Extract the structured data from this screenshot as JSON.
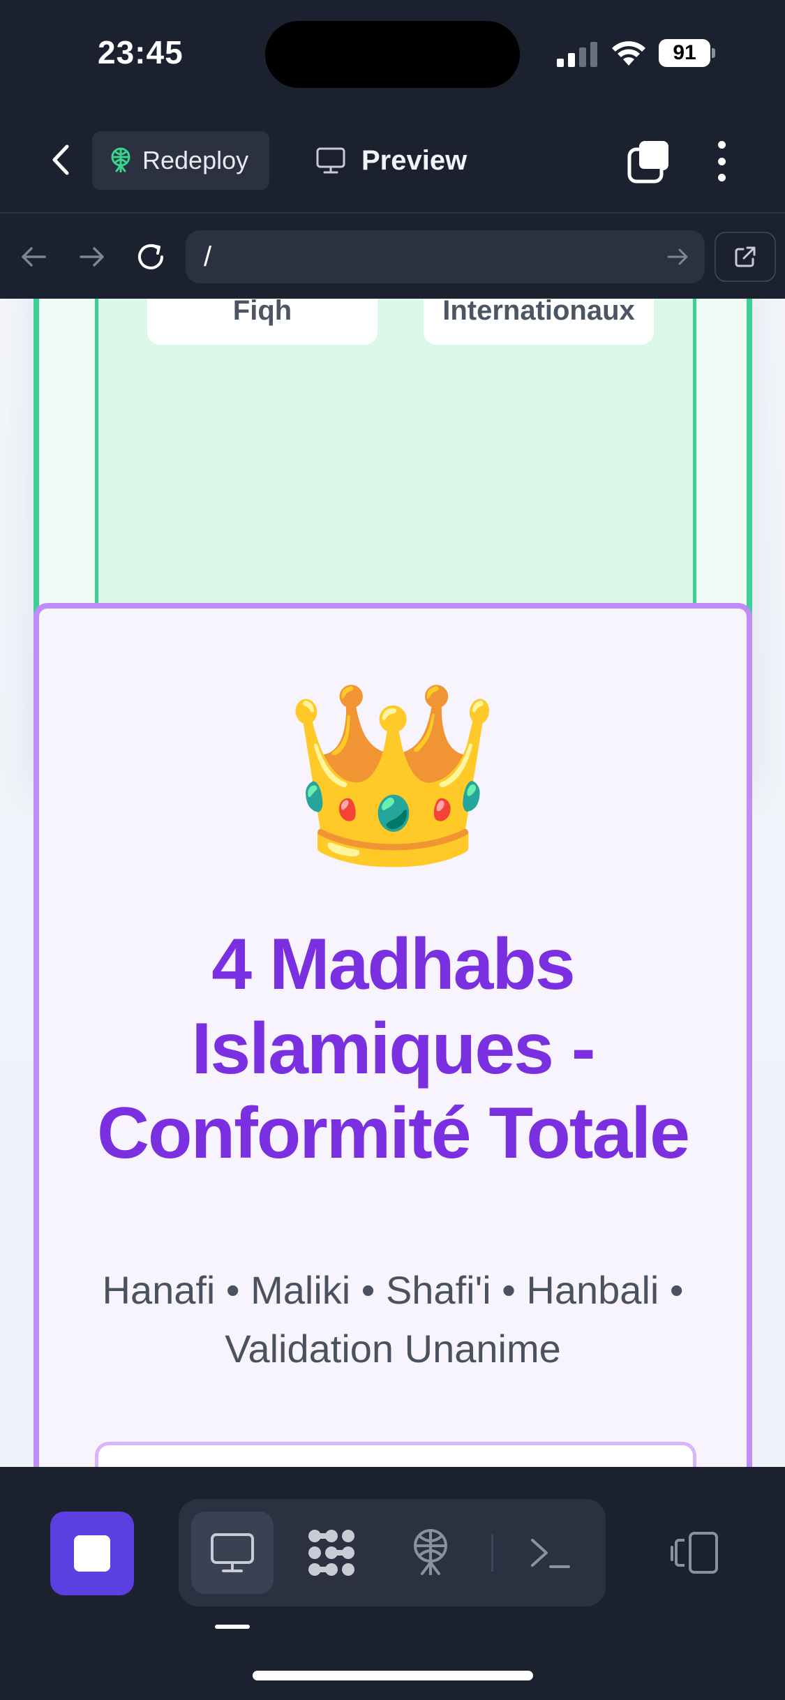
{
  "status_bar": {
    "time": "23:45",
    "battery": "91"
  },
  "header": {
    "redeploy_label": "Redeploy",
    "preview_label": "Preview"
  },
  "url_bar": {
    "path": "/"
  },
  "page": {
    "tags": [
      "Fiqh",
      "Internationaux"
    ],
    "crown_emoji": "👑",
    "title": "4 Madhabs Islamiques - Conformité Totale",
    "subtitle": "Hanafi • Maliki • Shafi'i • Hanbali • Validation Unanime"
  },
  "colors": {
    "app_bg": "#1c2130",
    "accent_purple": "#7a2fe0",
    "card_purple_border": "#c08cf5",
    "card_green_border": "#3ecf94",
    "stop_button": "#5b3fe0"
  },
  "icons": {
    "back": "chevron-left-icon",
    "redeploy": "antenna-icon",
    "preview": "monitor-icon",
    "windows": "stacked-windows-icon",
    "more": "vertical-dots-icon",
    "nav_back": "arrow-left-icon",
    "nav_forward": "arrow-right-icon",
    "reload": "reload-icon",
    "go": "arrow-right-icon",
    "external": "external-link-icon",
    "stop": "stop-icon",
    "tools": [
      "monitor-icon",
      "dots-grid-icon",
      "antenna-icon",
      "terminal-icon"
    ],
    "devices": "devices-icon"
  }
}
